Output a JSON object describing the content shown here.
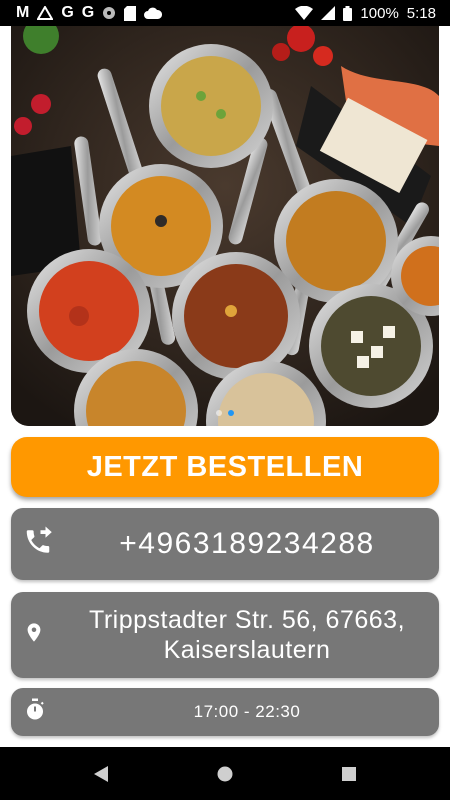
{
  "status_bar": {
    "left_icons": [
      "gmail-icon",
      "drive-icon",
      "google-icon",
      "google-icon",
      "photos-icon",
      "sd-card-icon",
      "cloud-icon"
    ],
    "google_letter": "G",
    "mail_letter": "M",
    "battery_percent": "100%",
    "time": "5:18"
  },
  "hero": {
    "image_name": "indian-dishes-photo",
    "slides": 2,
    "active_slide": 1
  },
  "order_button": {
    "label": "JETZT BESTELLEN"
  },
  "phone": {
    "icon": "phone-forward-icon",
    "number": "+4963189234288"
  },
  "address": {
    "icon": "location-pin-icon",
    "line1": "Trippstadter Str. 56, 67663,",
    "line2": "Kaiserslautern"
  },
  "hours": {
    "icon": "stopwatch-icon",
    "text": "17:00 - 22:30"
  },
  "colors": {
    "accent": "#ff9800",
    "card": "#777777",
    "text_on_card": "#ffffff"
  }
}
